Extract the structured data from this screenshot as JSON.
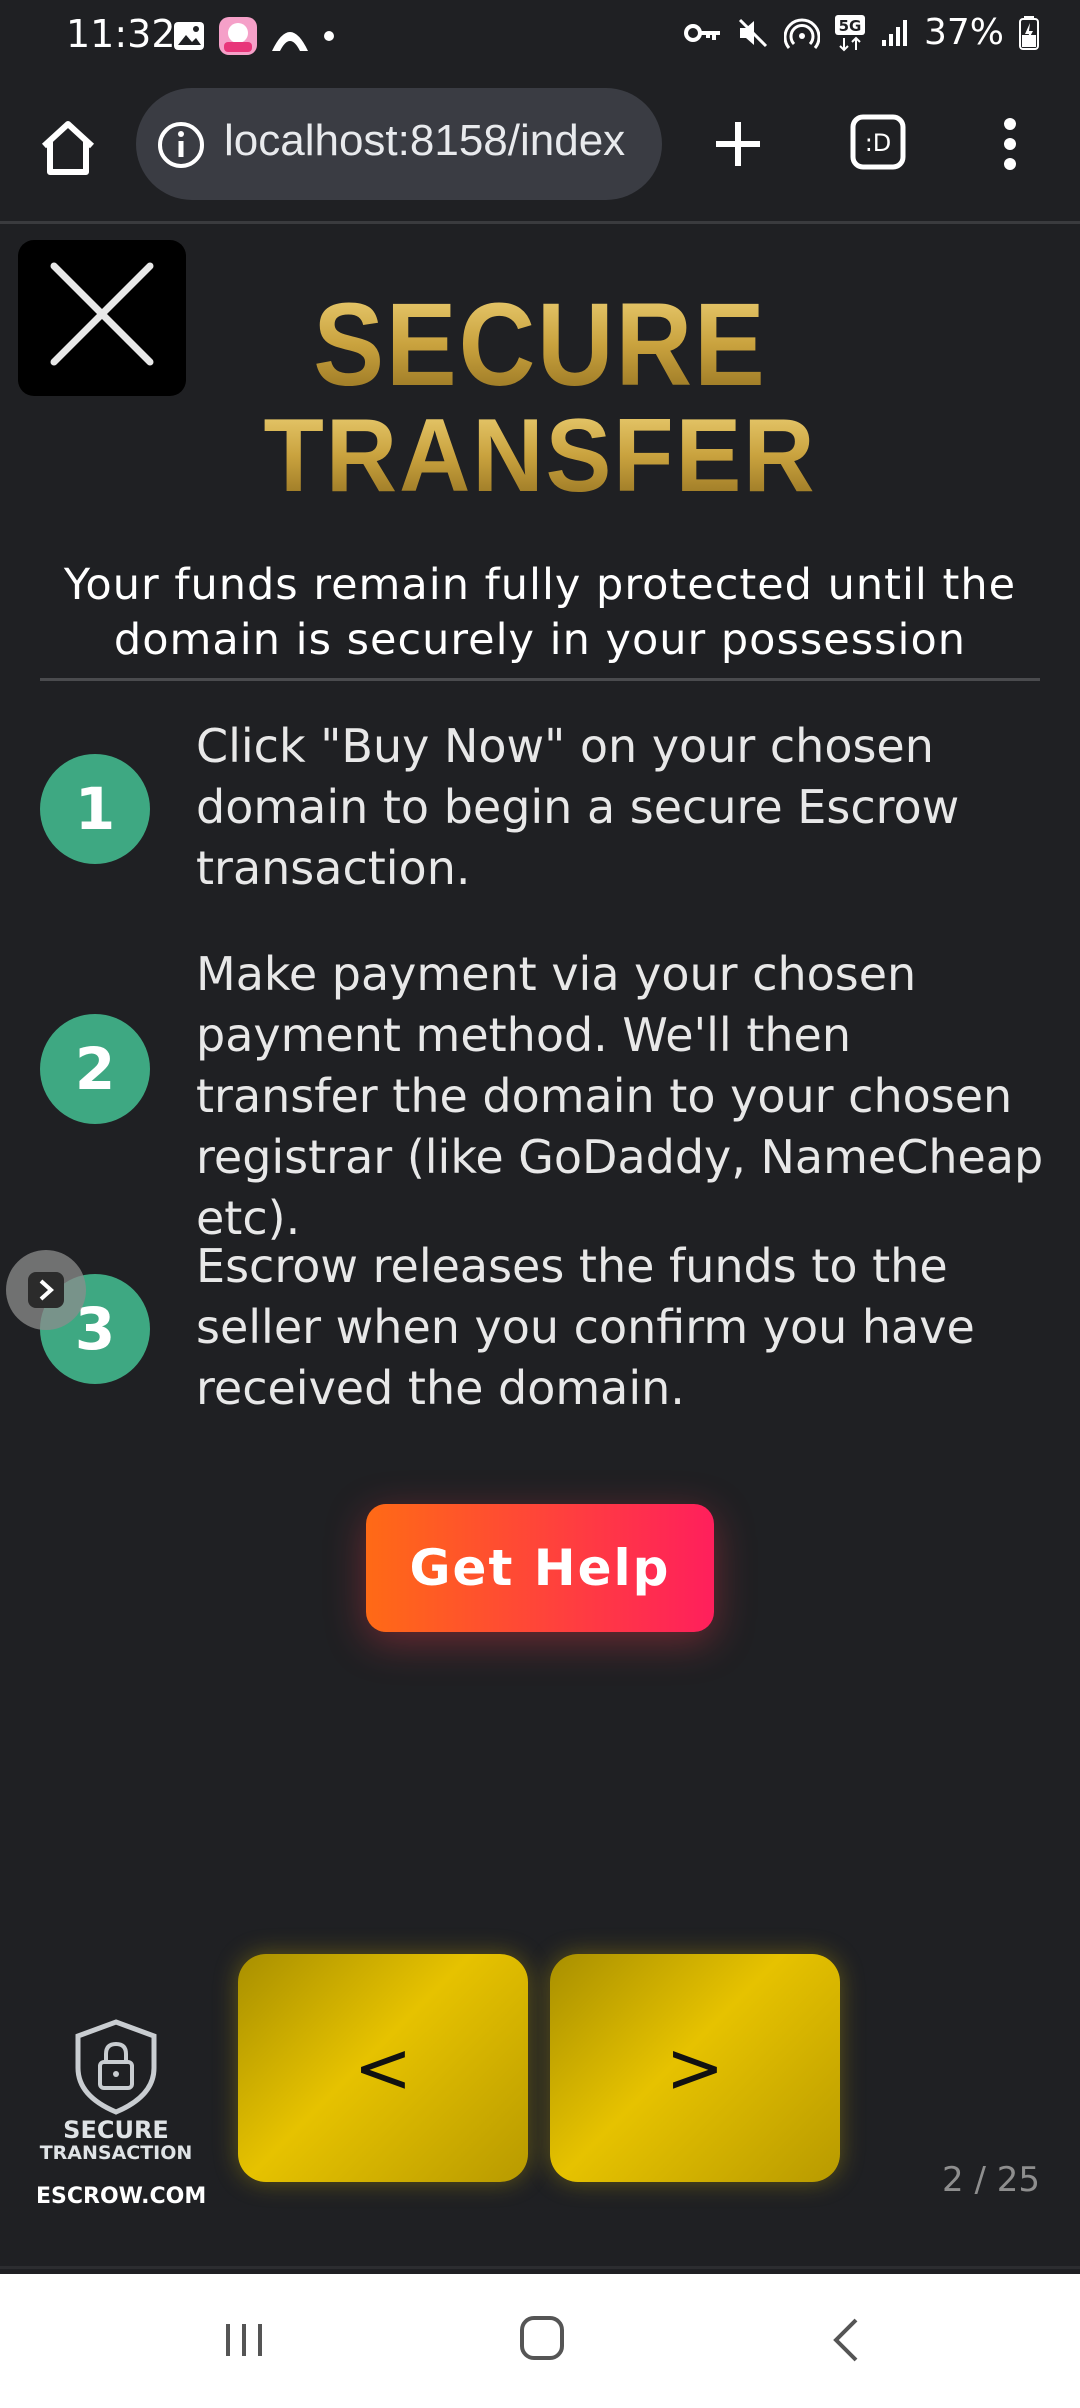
{
  "status_bar": {
    "time": "11:32",
    "battery": "37%",
    "network": "5G"
  },
  "browser": {
    "url": "localhost:8158/index",
    "tabs_label": ":D"
  },
  "page": {
    "title_line1": "SECURE",
    "title_line2": "TRANSFER",
    "subtitle": "Your funds remain fully protected until the domain is securely in your possession",
    "steps": [
      {
        "number": "1",
        "text": "Click \"Buy Now\" on your chosen domain to begin a secure Escrow transaction."
      },
      {
        "number": "2",
        "text": "Make payment via your chosen payment method. We'll then transfer the domain to your chosen registrar (like GoDaddy, NameCheap etc)."
      },
      {
        "number": "3",
        "text": "Escrow releases the funds to the seller when you confirm you have received the domain."
      }
    ],
    "help_button": "Get Help",
    "prev_label": "<",
    "next_label": ">",
    "page_counter": "2 / 25",
    "escrow_badge": {
      "line1": "SECURE",
      "line2": "TRANSACTION",
      "line3": "ESCROW.COM"
    }
  },
  "colors": {
    "background": "#1f2023",
    "gold": "#c9a23e",
    "step_circle": "#3ea882",
    "help_gradient_start": "#ff6a16",
    "help_gradient_end": "#ff1f5c",
    "nav_gold": "#e6c200"
  }
}
